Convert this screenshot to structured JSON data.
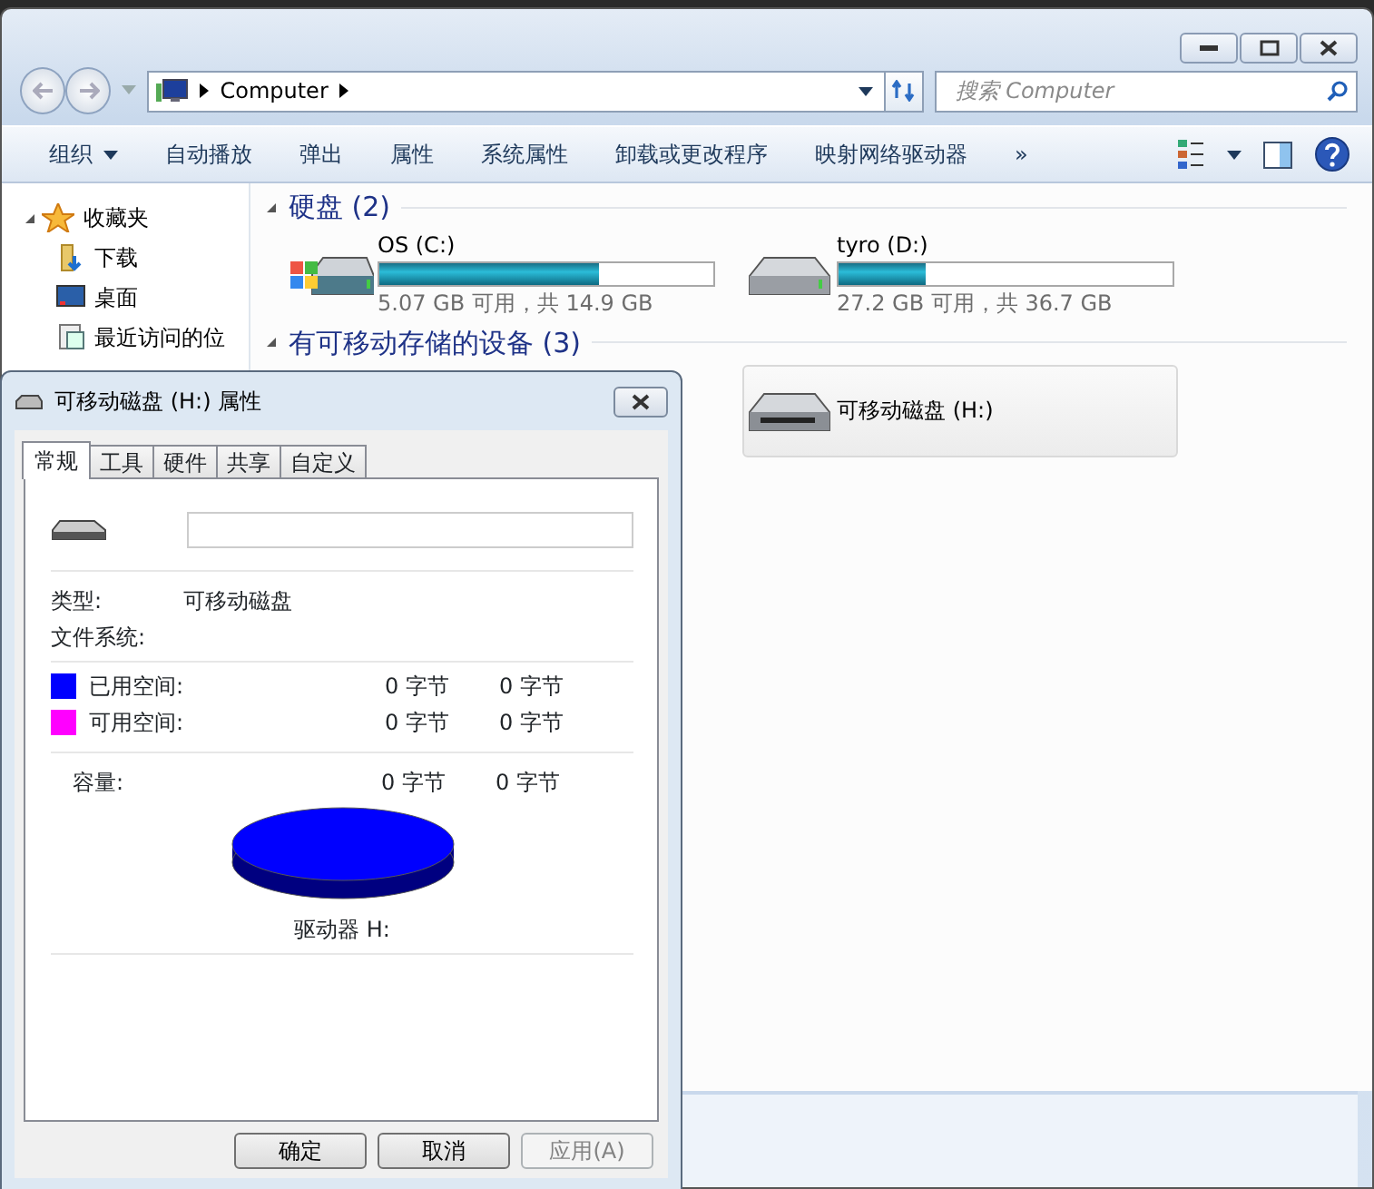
{
  "explorer": {
    "address": {
      "crumbs": [
        "Computer"
      ]
    },
    "search": {
      "placeholder": "搜索 Computer"
    },
    "toolbar": [
      {
        "label": "组织",
        "menu": true
      },
      {
        "label": "自动播放",
        "menu": false
      },
      {
        "label": "弹出",
        "menu": false
      },
      {
        "label": "属性",
        "menu": false
      },
      {
        "label": "系统属性",
        "menu": false
      },
      {
        "label": "卸载或更改程序",
        "menu": false
      },
      {
        "label": "映射网络驱动器",
        "menu": false
      },
      {
        "label": "»",
        "menu": false
      }
    ],
    "sidebar": [
      {
        "label": "收藏夹",
        "expanded": true,
        "children": [
          {
            "label": "下载"
          },
          {
            "label": "桌面"
          },
          {
            "label": "最近访问的位"
          }
        ]
      }
    ],
    "groups": [
      {
        "title": "硬盘 (2)",
        "expanded": true,
        "drives": [
          {
            "kind": "system",
            "name": "OS (C:)",
            "level": 0.66,
            "space": "5.07 GB 可用，共 14.9 GB",
            "selected": false
          },
          {
            "kind": "disk",
            "name": "tyro (D:)",
            "level": 0.26,
            "space": "27.2 GB 可用，共 36.7 GB",
            "selected": false
          }
        ]
      },
      {
        "title": "有可移动存储的设备 (3)",
        "expanded": true,
        "drives": [
          {
            "kind": "removable",
            "name": "可移动磁盘 (H:)",
            "selected": true
          }
        ]
      }
    ]
  },
  "dialog": {
    "title": "可移动磁盘 (H:) 属性",
    "tabs": [
      {
        "label": "常规",
        "selected": true
      },
      {
        "label": "工具",
        "selected": false
      },
      {
        "label": "硬件",
        "selected": false
      },
      {
        "label": "共享",
        "selected": false
      },
      {
        "label": "自定义",
        "selected": false
      }
    ],
    "type": {
      "label": "类型:",
      "value": "可移动磁盘"
    },
    "file_system": {
      "label": "文件系统:"
    },
    "space": [
      {
        "label": "已用空间:",
        "bytes": "0 字节",
        "size": "0 字节",
        "color": "#0000ff"
      },
      {
        "label": "可用空间:",
        "bytes": "0 字节",
        "size": "0 字节",
        "color": "#ff00ff"
      }
    ],
    "capacity": {
      "label": "容量:",
      "bytes": "0 字节",
      "size": "0 字节"
    },
    "drive_label": "驱动器 H:",
    "buttons": [
      {
        "label": "确定",
        "disabled": false
      },
      {
        "label": "取消",
        "disabled": false
      },
      {
        "label": "应用(A)",
        "disabled": true
      }
    ]
  }
}
